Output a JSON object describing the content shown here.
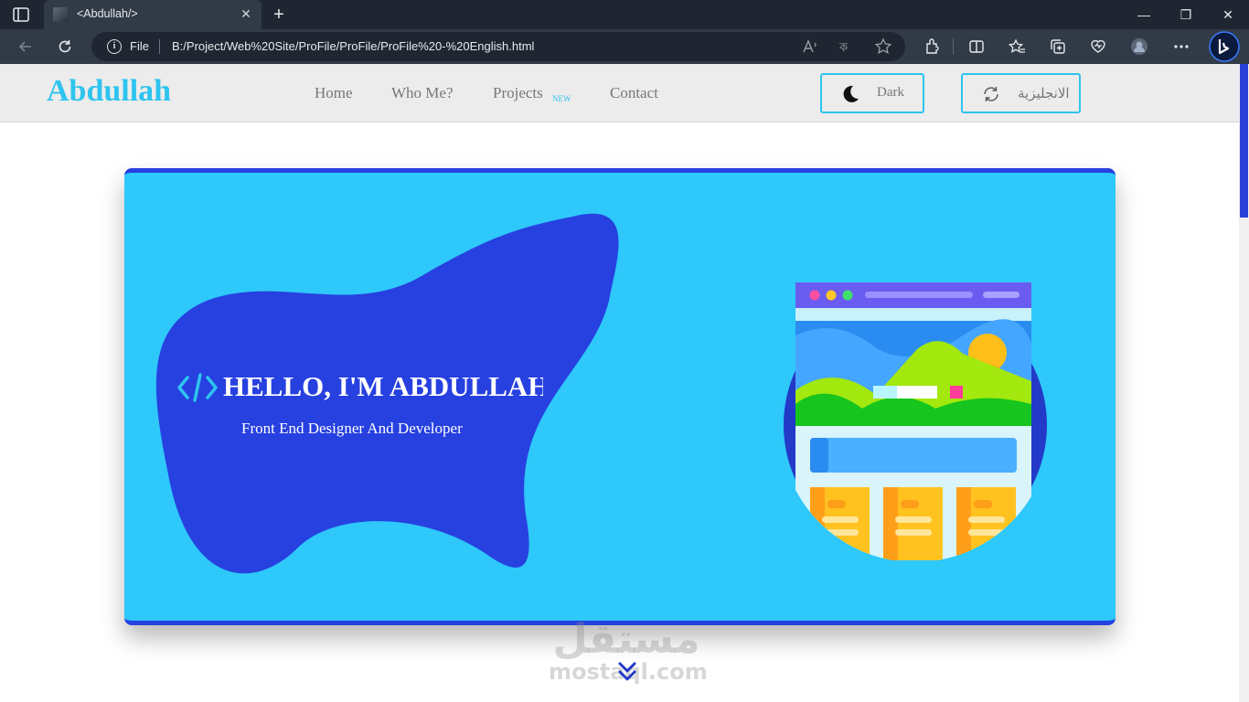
{
  "browser": {
    "tab_title": "<Abdullah/>",
    "tab_close": "✕",
    "new_tab": "+",
    "minimize": "—",
    "restore": "❐",
    "close": "✕",
    "address_scheme": "File",
    "address_url": "B:/Project/Web%20Site/ProFile/ProFile/ProFile%20-%20English.html"
  },
  "site": {
    "logo": "Abdullah",
    "nav": {
      "home": "Home",
      "who": "Who Me?",
      "projects": "Projects",
      "projects_badge": "NEW",
      "contact": "Contact"
    },
    "theme_button": "Dark",
    "language_button": "الانجليزية"
  },
  "hero": {
    "title": "HELLO, I'M ABDULLAH",
    "subtitle": "Front End Designer And Developer"
  },
  "watermark": {
    "arabic": "مستقل",
    "latin": "mostaql.com"
  },
  "colors": {
    "accent": "#2ec4ef",
    "hero_bg": "#2ec8fb",
    "blob": "#2740e0",
    "chrome_dark": "#1f2631"
  }
}
